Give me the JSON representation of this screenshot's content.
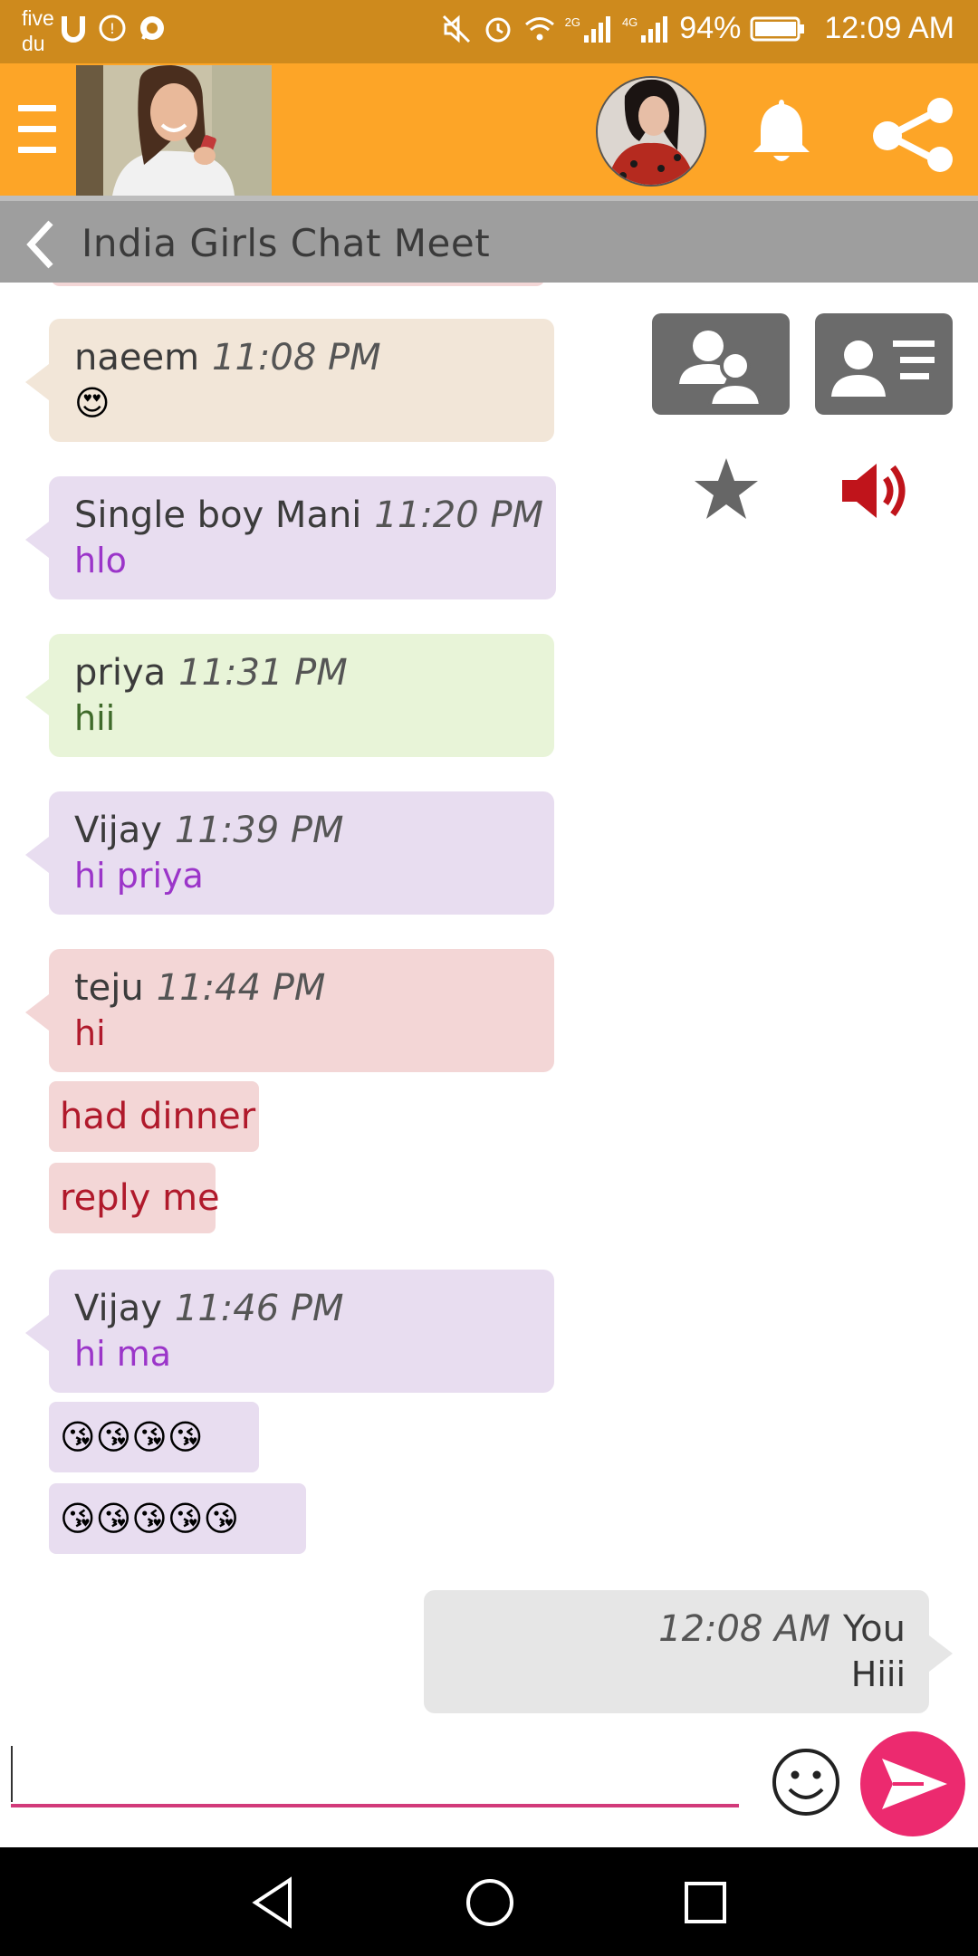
{
  "status_bar": {
    "carrier_line1": "five",
    "carrier_line2": "du",
    "network_2g": "2G",
    "network_4g": "4G",
    "battery": "94%",
    "time": "12:09 AM"
  },
  "header": {
    "title": "India Girls Chat Meet"
  },
  "messages": [
    {
      "name": "naeem",
      "time": "11:08 PM",
      "text": "😍",
      "color": "#f2e6d8",
      "text_color": "#333333"
    },
    {
      "name": "Single boy Mani",
      "time": "11:20 PM",
      "text": "hlo",
      "color": "#e8ddf0",
      "text_color": "#9b35c9"
    },
    {
      "name": "priya",
      "time": "11:31 PM",
      "text": "hii",
      "color": "#e8f4d8",
      "text_color": "#3f6a2a"
    },
    {
      "name": "Vijay",
      "time": "11:39 PM",
      "text": "hi priya",
      "color": "#e8ddf0",
      "text_color": "#9b35c9"
    },
    {
      "name": "teju",
      "time": "11:44 PM",
      "text": "hi",
      "color": "#f3d6d6",
      "text_color": "#b0192b"
    },
    {
      "name": "Vijay",
      "time": "11:46 PM",
      "text": "hi ma",
      "color": "#e8ddf0",
      "text_color": "#9b35c9"
    }
  ],
  "followups": {
    "teju_1": "had dinner",
    "teju_2": "reply me",
    "vijay_1": "😘😘😘😘",
    "vijay_2": "😘😘😘😘😘"
  },
  "outgoing": {
    "time": "12:08 AM",
    "name": "You",
    "text": "Hiii"
  },
  "input": {
    "value": "",
    "placeholder": ""
  },
  "icons": {
    "menu": "menu-icon",
    "bell": "bell-icon",
    "share": "share-icon",
    "back": "chevron-left-icon",
    "users": "users-icon",
    "profile_card": "profile-card-icon",
    "star": "star-icon",
    "speaker": "speaker-icon",
    "emoji": "smiley-icon",
    "send": "send-icon"
  },
  "colors": {
    "header": "#fda527",
    "status_bar": "#ce8a1d",
    "title_bar": "#9e9e9e",
    "send_button": "#ec2a6f",
    "speaker": "#c0141b"
  }
}
